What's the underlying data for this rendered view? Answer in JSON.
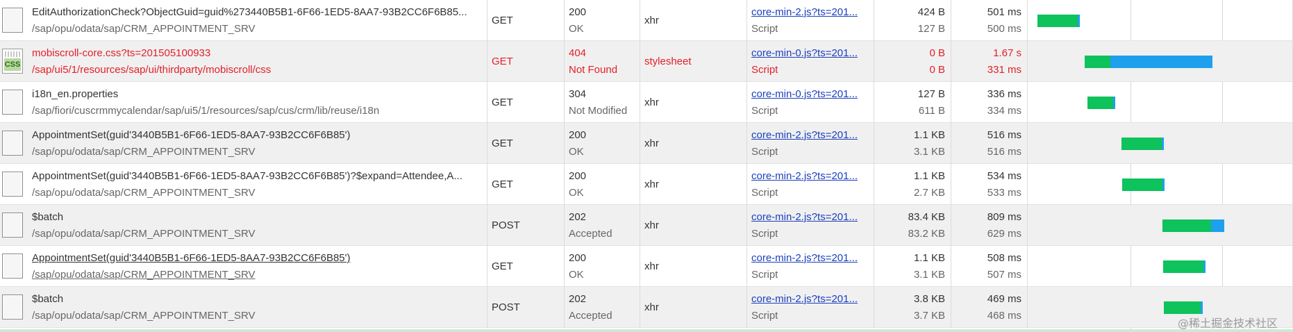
{
  "requests": [
    {
      "name": "EditAuthorizationCheck?ObjectGuid=guid%273440B5B1-6F66-1ED5-8AA7-93B2CC6F6B85...",
      "path": "/sap/opu/odata/sap/CRM_APPOINTMENT_SRV",
      "method": "GET",
      "status_code": "200",
      "status_text": "OK",
      "type": "xhr",
      "initiator": "core-min-2.js?ts=201...",
      "initiator_type": "Script",
      "size_received": "424 B",
      "size_content": "127 B",
      "time_total": "501 ms",
      "time_latency": "500 ms",
      "icon": "generic-file-icon",
      "waterfall": {
        "start": 0.037,
        "wait": 0.152,
        "receive": 0.006
      }
    },
    {
      "name": "mobiscroll-core.css?ts=201505100933",
      "path": "/sap/ui5/1/resources/sap/ui/thirdparty/mobiscroll/css",
      "method": "GET",
      "status_code": "404",
      "status_text": "Not Found",
      "type": "stylesheet",
      "initiator": "core-min-0.js?ts=201...",
      "initiator_type": "Script",
      "size_received": "0 B",
      "size_content": "0 B",
      "time_total": "1.67 s",
      "time_latency": "331 ms",
      "icon": "css-file-icon",
      "icon_badge": "CSS",
      "waterfall": {
        "start": 0.214,
        "wait": 0.097,
        "receive": 0.385
      }
    },
    {
      "name": "i18n_en.properties",
      "path": "/sap/fiori/cuscrmmycalendar/sap/ui5/1/resources/sap/cus/crm/lib/reuse/i18n",
      "method": "GET",
      "status_code": "304",
      "status_text": "Not Modified",
      "type": "xhr",
      "initiator": "core-min-0.js?ts=201...",
      "initiator_type": "Script",
      "size_received": "127 B",
      "size_content": "611 B",
      "time_total": "336 ms",
      "time_latency": "334 ms",
      "icon": "generic-file-icon",
      "waterfall": {
        "start": 0.225,
        "wait": 0.097,
        "receive": 0.008
      }
    },
    {
      "name": "AppointmentSet(guid'3440B5B1-6F66-1ED5-8AA7-93B2CC6F6B85')",
      "path": "/sap/opu/odata/sap/CRM_APPOINTMENT_SRV",
      "method": "GET",
      "status_code": "200",
      "status_text": "OK",
      "type": "xhr",
      "initiator": "core-min-2.js?ts=201...",
      "initiator_type": "Script",
      "size_received": "1.1 KB",
      "size_content": "3.1 KB",
      "time_total": "516 ms",
      "time_latency": "516 ms",
      "icon": "generic-file-icon",
      "waterfall": {
        "start": 0.353,
        "wait": 0.152,
        "receive": 0.008
      }
    },
    {
      "name": "AppointmentSet(guid'3440B5B1-6F66-1ED5-8AA7-93B2CC6F6B85')?$expand=Attendee,A...",
      "path": "/sap/opu/odata/sap/CRM_APPOINTMENT_SRV",
      "method": "GET",
      "status_code": "200",
      "status_text": "OK",
      "type": "xhr",
      "initiator": "core-min-2.js?ts=201...",
      "initiator_type": "Script",
      "size_received": "1.1 KB",
      "size_content": "2.7 KB",
      "time_total": "534 ms",
      "time_latency": "533 ms",
      "icon": "generic-file-icon",
      "waterfall": {
        "start": 0.356,
        "wait": 0.152,
        "receive": 0.008
      }
    },
    {
      "name": "$batch",
      "path": "/sap/opu/odata/sap/CRM_APPOINTMENT_SRV",
      "method": "POST",
      "status_code": "202",
      "status_text": "Accepted",
      "type": "xhr",
      "initiator": "core-min-2.js?ts=201...",
      "initiator_type": "Script",
      "size_received": "83.4 KB",
      "size_content": "83.2 KB",
      "time_total": "809 ms",
      "time_latency": "629 ms",
      "icon": "generic-file-icon",
      "waterfall": {
        "start": 0.508,
        "wait": 0.183,
        "receive": 0.05
      }
    },
    {
      "name": "AppointmentSet(guid'3440B5B1-6F66-1ED5-8AA7-93B2CC6F6B85')",
      "path": "/sap/opu/odata/sap/CRM_APPOINTMENT_SRV",
      "method": "GET",
      "status_code": "200",
      "status_text": "OK",
      "type": "xhr",
      "initiator": "core-min-2.js?ts=201...",
      "initiator_type": "Script",
      "size_received": "1.1 KB",
      "size_content": "3.1 KB",
      "time_total": "508 ms",
      "time_latency": "507 ms",
      "icon": "generic-file-icon",
      "highlighted": true,
      "waterfall": {
        "start": 0.511,
        "wait": 0.152,
        "receive": 0.008
      }
    },
    {
      "name": "$batch",
      "path": "/sap/opu/odata/sap/CRM_APPOINTMENT_SRV",
      "method": "POST",
      "status_code": "202",
      "status_text": "Accepted",
      "type": "xhr",
      "initiator": "core-min-2.js?ts=201...",
      "initiator_type": "Script",
      "size_received": "3.8 KB",
      "size_content": "3.7 KB",
      "time_total": "469 ms",
      "time_latency": "468 ms",
      "icon": "generic-file-icon",
      "waterfall": {
        "start": 0.513,
        "wait": 0.139,
        "receive": 0.008
      }
    }
  ],
  "colors": {
    "wait": "#0ec25c",
    "receive": "#1ea0ec",
    "error_text": "#e3202a",
    "link": "#1a3fbf"
  },
  "watermark": "@稀土掘金技术社区"
}
